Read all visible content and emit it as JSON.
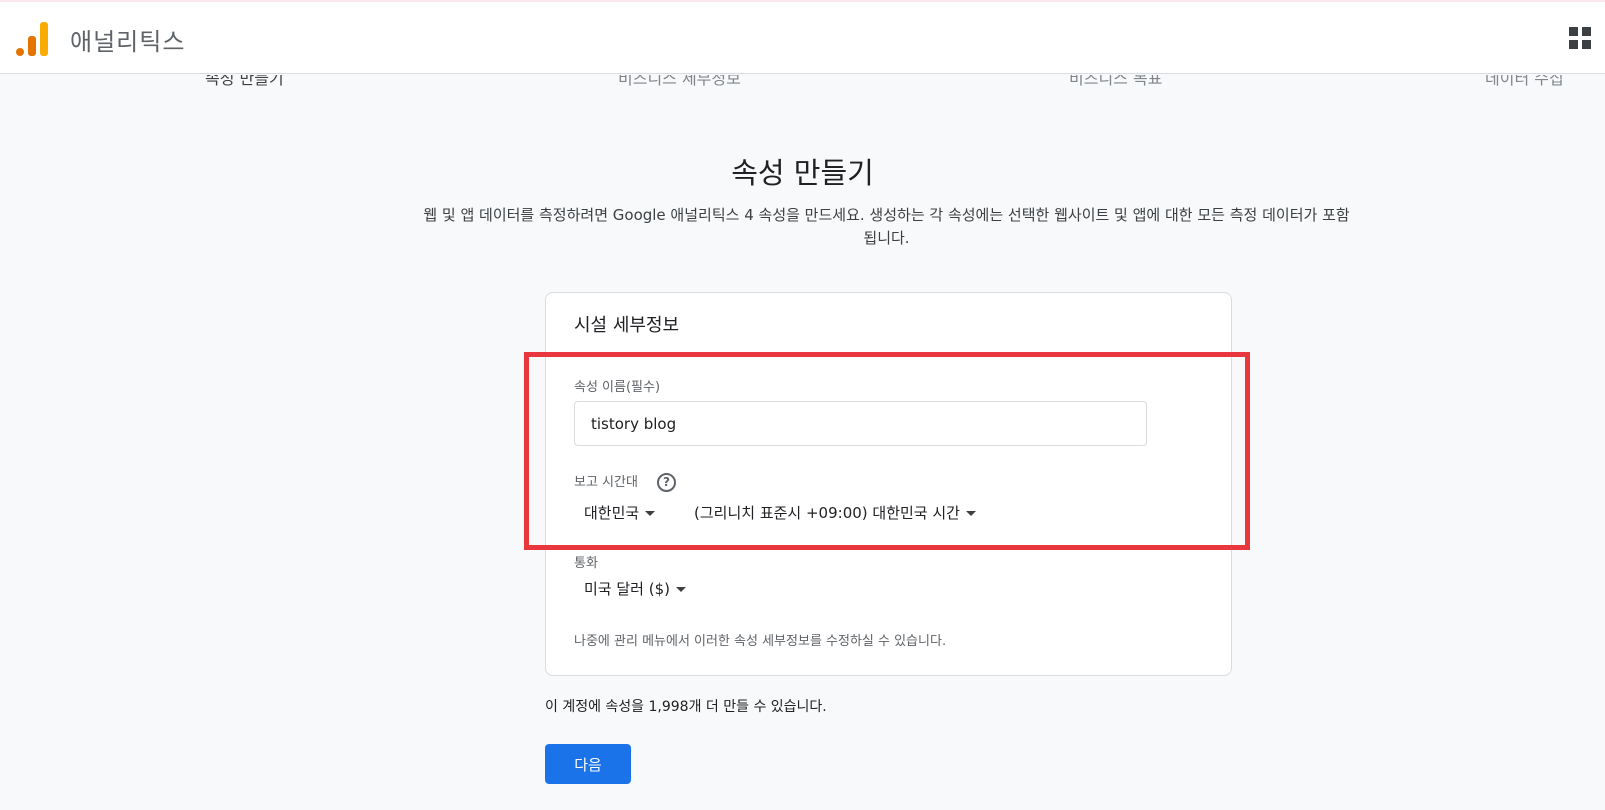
{
  "app": {
    "title": "애널리틱스",
    "logo_icon": "analytics-bars-icon",
    "apps_icon": "apps-grid-icon"
  },
  "steps": [
    {
      "label": "속성 만들기",
      "active": true
    },
    {
      "label": "비즈니스 세부정보",
      "active": false
    },
    {
      "label": "비즈니스 목표",
      "active": false
    },
    {
      "label": "데이터 수집",
      "active": false
    }
  ],
  "page": {
    "title": "속성 만들기",
    "description": "웹 및 앱 데이터를 측정하려면 Google 애널리틱스 4 속성을 만드세요. 생성하는 각 속성에는 선택한 웹사이트 및 앱에 대한 모든 측정 데이터가 포함됩니다."
  },
  "card": {
    "title": "시설 세부정보",
    "property_name_label": "속성 이름(필수)",
    "property_name_value": "tistory blog",
    "timezone_label": "보고 시간대",
    "timezone_help_icon": "help-circle-icon",
    "timezone_country": "대한민국",
    "timezone_value": "(그리니치 표준시 +09:00) 대한민국 시간",
    "currency_label": "통화",
    "currency_value": "미국 달러 ($)",
    "note": "나중에 관리 메뉴에서 이러한 속성 세부정보를 수정하실 수 있습니다."
  },
  "quota_text": "이 계정에 속성을 1,998개 더 만들 수 있습니다.",
  "next_button": "다음",
  "colors": {
    "primary": "#1a73e8",
    "highlight_border": "#e8383d",
    "logo_orange": "#e37400",
    "logo_yellow": "#f9ab00"
  }
}
